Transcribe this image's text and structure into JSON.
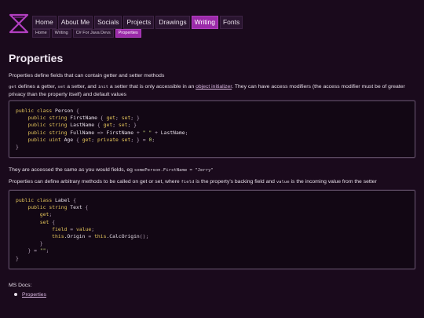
{
  "nav": {
    "items": [
      "Home",
      "About Me",
      "Socials",
      "Projects",
      "Drawings",
      "Writing",
      "Fonts"
    ],
    "active": "Writing"
  },
  "breadcrumb": [
    "Home",
    "Writing",
    "C# For Java Devs",
    "Properties"
  ],
  "page": {
    "title": "Properties",
    "intro": "Properties define fields that can contain getter and setter methods",
    "p2_get": "get",
    "p2_a": " defines a getter, ",
    "p2_set": "set",
    "p2_b": " a setter, and ",
    "p2_init": "init",
    "p2_c": " a setter that is only accessible in an ",
    "p2_link": "object initializer",
    "p2_d": ". They can have access modifiers (the access modifier must be of greater privacy than the property itself) and default values",
    "p3_a": "They are accessed the same as you would fields, eg ",
    "p3_code": "somePerson.FirstName = \"Jerry\"",
    "p4_a": "Properties can define arbitrary methods to be called on get or set, where ",
    "p4_field": "field",
    "p4_b": " is the property's backing field and ",
    "p4_value": "value",
    "p4_c": " is the incoming value from the setter",
    "docs_label": "MS Docs:",
    "docs_link": "Properties"
  },
  "code1": [
    "public class Person {",
    "    public string FirstName { get; set; }",
    "    public string LastName { get; set; }",
    "    public string FullName => FirstName + \" \" + LastName;",
    "    public uint Age { get; private set; } = 0;",
    "}"
  ],
  "code2": [
    "public class Label {",
    "    public string Text {",
    "        get;",
    "        set {",
    "            field = value;",
    "            this.Origin = this.CalcOrigin();",
    "        }",
    "    } = \"\";",
    "}"
  ],
  "colors": {
    "accent": "#9a2aa8",
    "background": "#1a0a1c",
    "keyword": "#e2c35a"
  }
}
